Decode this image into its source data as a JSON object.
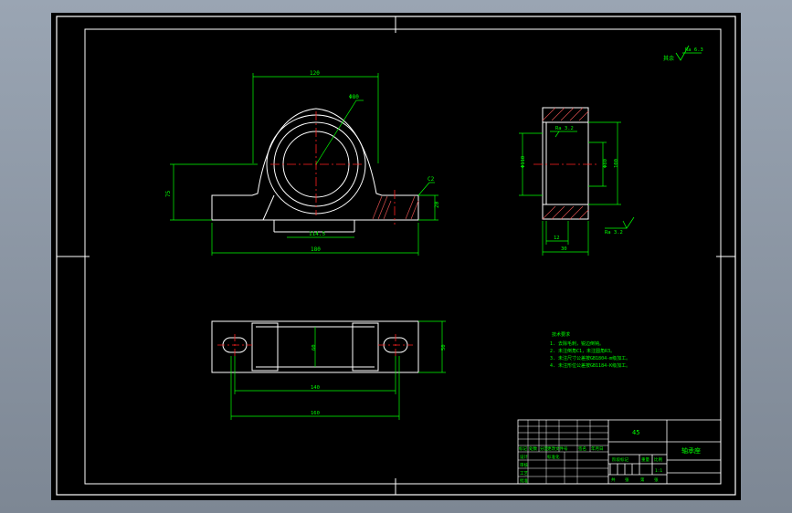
{
  "drawing": {
    "roughness_note": "Ra 6.3",
    "front_view": {
      "dim_top": "120",
      "dim_diameter": "Φ80",
      "dim_height": "75",
      "dim_base_inner": "114.5",
      "dim_base_total": "180",
      "dim_base_height": "20",
      "dim_chamfer": "C2"
    },
    "side_view": {
      "roughness_top": "Ra 3.2",
      "roughness_bottom": "Ra 3.2",
      "dim_left": "Φ110",
      "dim_right_a": "Φ80",
      "dim_right_b": "100",
      "dim_bottom_a": "12",
      "dim_bottom_b": "30"
    },
    "top_view": {
      "dim_mid": "60",
      "dim_right": "50",
      "dim_holes": "140",
      "dim_total": "160"
    },
    "tech_requirements": {
      "title": "技术要求",
      "lines": [
        "1. 去除毛刺，锐边倒钝。",
        "2. 未注倒角C1，未注圆角R3。",
        "3. 未注尺寸公差按GB1804-m级加工。",
        "4. 未注形位公差按GB1184-K级加工。"
      ]
    },
    "title_block": {
      "material": "45",
      "part_name": "轴承座",
      "scale": "1:1",
      "header_cells": [
        "标记",
        "处数",
        "分区",
        "更改文件号",
        "签名",
        "年月日"
      ],
      "row_labels": [
        "设计",
        "审核",
        "工艺",
        "批准"
      ],
      "standardization": "标准化",
      "stage_label": "阶段标记",
      "weight_label": "重量",
      "ratio_label": "比例",
      "sheet_labels": [
        "共",
        "张",
        "第",
        "张"
      ]
    }
  },
  "colors": {
    "line": "#ffffff",
    "dimension": "#00ff00",
    "centerline": "#ff2020",
    "hatch": "#e05050"
  }
}
